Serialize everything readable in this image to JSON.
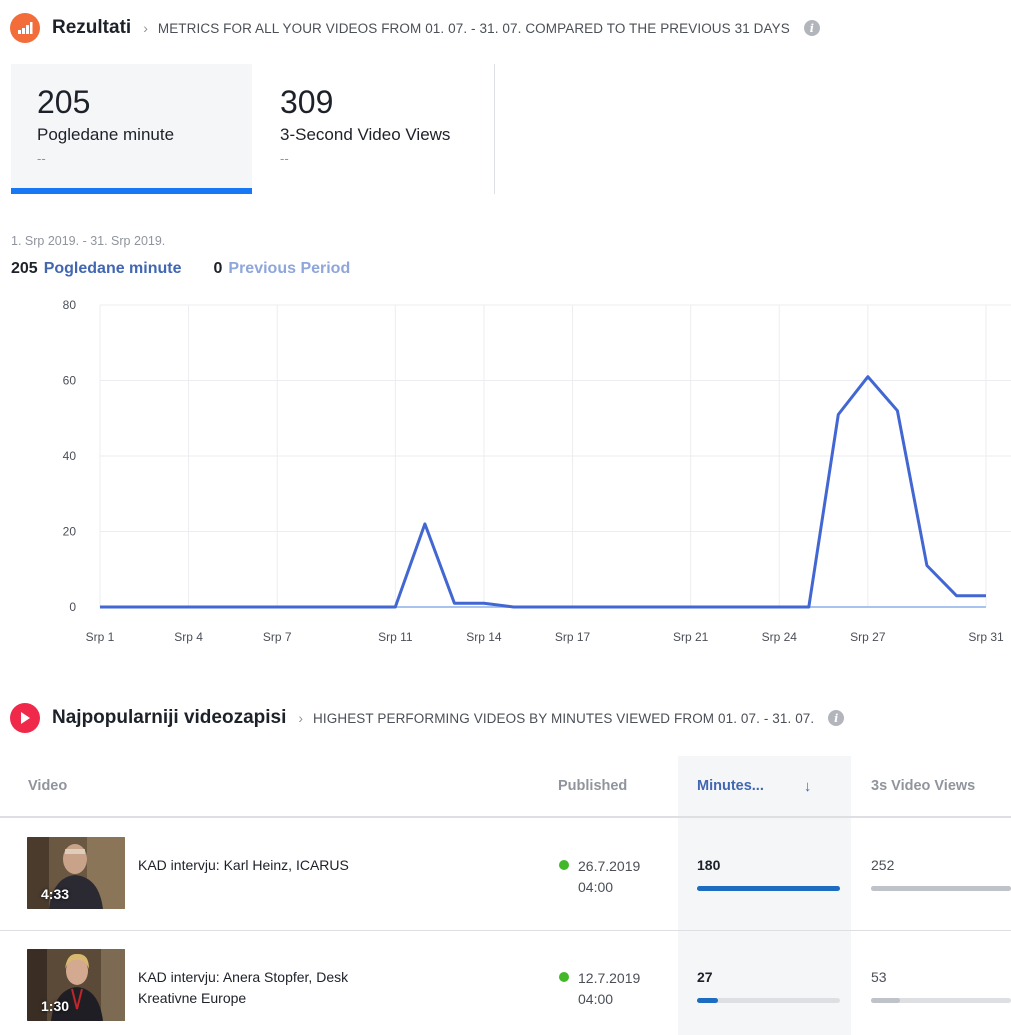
{
  "results_section": {
    "title": "Rezultati",
    "subtitle": "METRICS FOR ALL YOUR VIDEOS FROM 01. 07. - 31. 07. COMPARED TO THE PREVIOUS 31 DAYS",
    "info": "i",
    "icon": "bar-chart-icon",
    "icon_color": "#f36d3a"
  },
  "metrics": [
    {
      "value": "205",
      "label": "Pogledane minute",
      "compare": "--",
      "active": true
    },
    {
      "value": "309",
      "label": "3-Second Video Views",
      "compare": "--",
      "active": false
    }
  ],
  "chart_header": {
    "date_range": "1. Srp 2019. - 31. Srp 2019.",
    "current_total": "205",
    "current_label": "Pogledane minute",
    "previous_total": "0",
    "previous_label": "Previous Period"
  },
  "chart_data": {
    "type": "line",
    "x": [
      "Srp 1",
      "Srp 2",
      "Srp 3",
      "Srp 4",
      "Srp 5",
      "Srp 6",
      "Srp 7",
      "Srp 8",
      "Srp 9",
      "Srp 10",
      "Srp 11",
      "Srp 12",
      "Srp 13",
      "Srp 14",
      "Srp 15",
      "Srp 16",
      "Srp 17",
      "Srp 18",
      "Srp 19",
      "Srp 20",
      "Srp 21",
      "Srp 22",
      "Srp 23",
      "Srp 24",
      "Srp 25",
      "Srp 26",
      "Srp 27",
      "Srp 28",
      "Srp 29",
      "Srp 30",
      "Srp 31"
    ],
    "x_tick_labels": [
      "Srp 1",
      "Srp 4",
      "Srp 7",
      "Srp 11",
      "Srp 14",
      "Srp 17",
      "Srp 21",
      "Srp 24",
      "Srp 27",
      "Srp 31"
    ],
    "series": [
      {
        "name": "Pogledane minute",
        "color": "#4267d2",
        "values": [
          0,
          0,
          0,
          0,
          0,
          0,
          0,
          0,
          0,
          0,
          0,
          22,
          1,
          1,
          0,
          0,
          0,
          0,
          0,
          0,
          0,
          0,
          0,
          0,
          0,
          51,
          61,
          52,
          11,
          3,
          3
        ]
      },
      {
        "name": "Previous Period",
        "color": "#a8c4ee",
        "values": [
          0,
          0,
          0,
          0,
          0,
          0,
          0,
          0,
          0,
          0,
          0,
          0,
          0,
          0,
          0,
          0,
          0,
          0,
          0,
          0,
          0,
          0,
          0,
          0,
          0,
          0,
          0,
          0,
          0,
          0,
          0
        ]
      }
    ],
    "y_ticks": [
      0,
      20,
      40,
      60,
      80
    ],
    "ylim": [
      0,
      80
    ],
    "grid": true
  },
  "videos_section": {
    "title": "Najpopularniji videozapisi",
    "subtitle": "HIGHEST PERFORMING VIDEOS BY MINUTES VIEWED FROM 01. 07. - 31. 07.",
    "info": "i",
    "icon": "play-icon",
    "icon_color": "#f0284a"
  },
  "table": {
    "headers": {
      "video": "Video",
      "published": "Published",
      "minutes": "Minutes...",
      "views": "3s Video Views"
    },
    "sort_icon": "arrow-down-icon",
    "rows": [
      {
        "title": "KAD intervju: Karl Heinz, ICARUS",
        "duration": "4:33",
        "date": "26.7.2019",
        "time": "04:00",
        "minutes": "180",
        "views": "252",
        "minutes_fraction": 1.0,
        "views_fraction": 1.0
      },
      {
        "title": "KAD intervju: Anera Stopfer, Desk Kreativne Europe",
        "duration": "1:30",
        "date": "12.7.2019",
        "time": "04:00",
        "minutes": "27",
        "views": "53",
        "minutes_fraction": 0.15,
        "views_fraction": 0.21
      }
    ]
  }
}
